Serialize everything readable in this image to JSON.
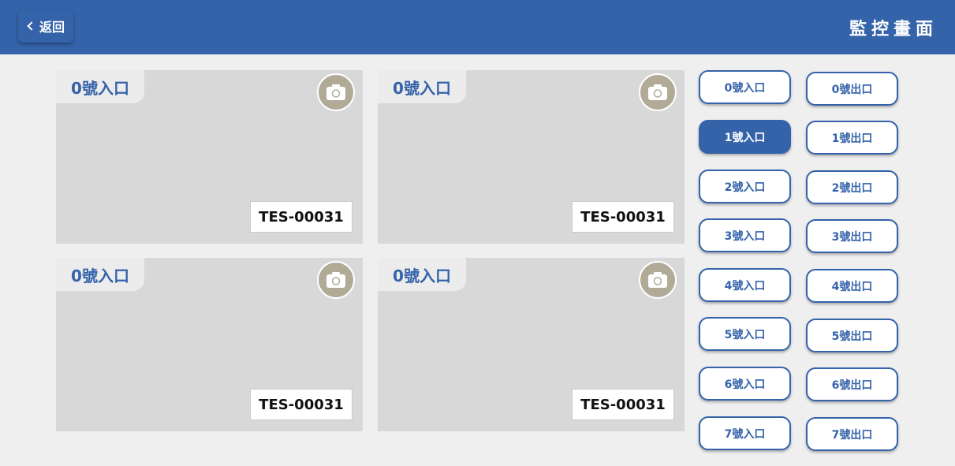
{
  "header": {
    "back_label": "返回",
    "title": "監控畫面"
  },
  "cameras": [
    {
      "label": "0號入口",
      "plate": "TES-00031"
    },
    {
      "label": "0號入口",
      "plate": "TES-00031"
    },
    {
      "label": "0號入口",
      "plate": "TES-00031"
    },
    {
      "label": "0號入口",
      "plate": "TES-00031"
    }
  ],
  "gates": {
    "entrances": [
      "0號入口",
      "1號入口",
      "2號入口",
      "3號入口",
      "4號入口",
      "5號入口",
      "6號入口",
      "7號入口"
    ],
    "exits": [
      "0號出口",
      "1號出口",
      "2號出口",
      "3號出口",
      "4號出口",
      "5號出口",
      "6號出口",
      "7號出口"
    ],
    "selected": "1號入口"
  },
  "icons": {
    "back": "chevron-left-icon",
    "snapshot": "camera-icon"
  },
  "colors": {
    "primary": "#3463aa",
    "snapshot_button": "#b1aa96",
    "feed_background": "#d8d8d8"
  }
}
